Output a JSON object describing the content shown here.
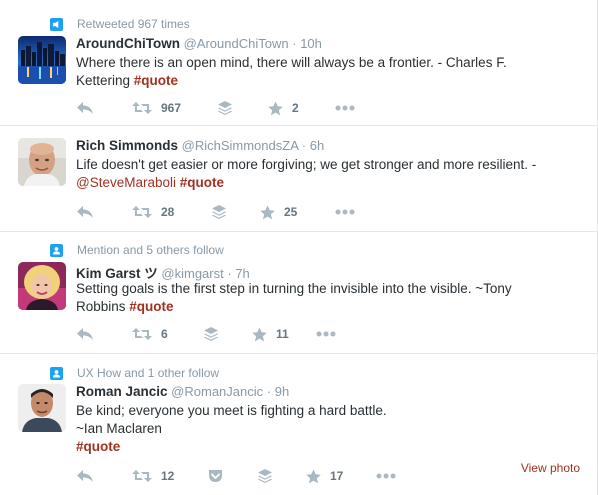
{
  "tweets": [
    {
      "context": "Retweeted 967 times",
      "context_icon": "retweet-context-icon",
      "name": "AroundChiTown",
      "handle": "@AroundChiTown",
      "time": "10h",
      "text_line1": "Where there is an open mind, there will always be a frontier. - Charles F.",
      "text_line2_prefix": "Kettering ",
      "hashtag": "#quote",
      "reply_icon": "reply-icon",
      "retweet_count": "967",
      "favorite_count": "2"
    },
    {
      "name": "Rich Simmonds",
      "handle": "@RichSimmondsZA",
      "time": "6h",
      "text_line1": "Life doesn't get easier or more forgiving; we get stronger and more resilient. -",
      "mention": "@SteveMaraboli",
      "hashtag": "#quote",
      "retweet_count": "28",
      "favorite_count": "25"
    },
    {
      "context": "Mention and 5 others follow",
      "name": "Kim Garst ツ",
      "handle": "@kimgarst",
      "time": "7h",
      "text_line1": "Setting goals is the first step in turning the invisible into the visible. ~Tony",
      "text_line2_prefix": "Robbins ",
      "hashtag": "#quote",
      "retweet_count": "6",
      "favorite_count": "11"
    },
    {
      "context": "UX How and 1 other follow",
      "name": "Roman Jancic",
      "handle": "@RomanJancic",
      "time": "9h",
      "text_line1": "Be kind; everyone you meet is fighting a hard battle.",
      "text_line2": "~Ian Maclaren",
      "hashtag": "#quote",
      "retweet_count": "12",
      "favorite_count": "17",
      "view_photo": "View photo"
    }
  ],
  "separator_dot": "·",
  "colors": {
    "accent_link": "#a1321f",
    "context_blue": "#1da1f2",
    "muted": "#8899a6",
    "text": "#292f33",
    "border": "#e1e8ed"
  }
}
